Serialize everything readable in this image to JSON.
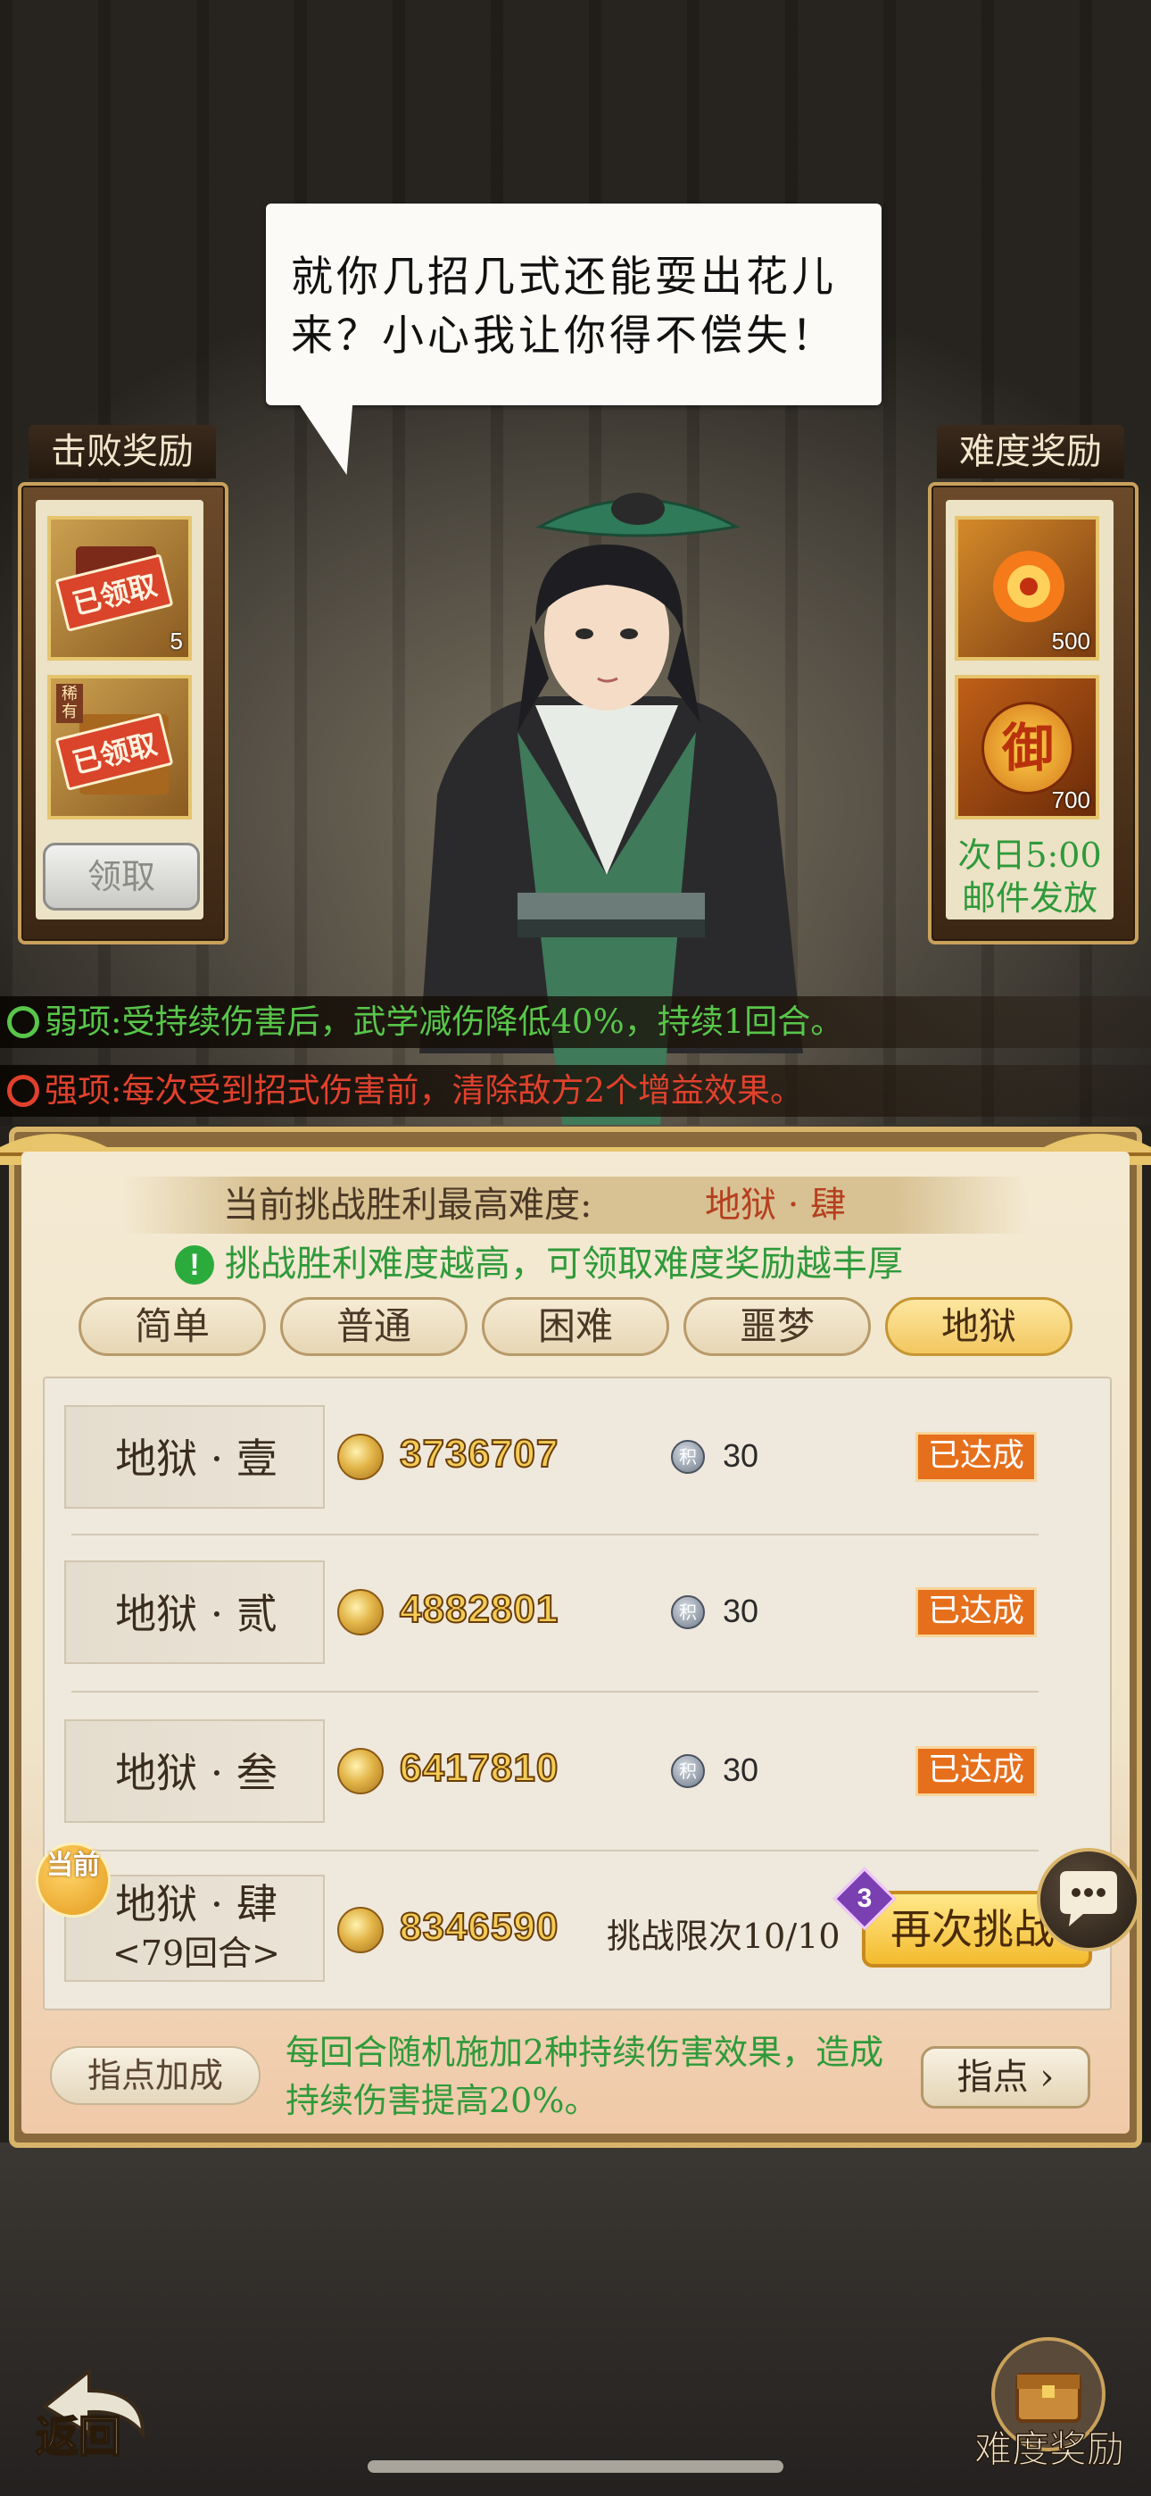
{
  "dialogue": "就你几招几式还能耍出花儿来？小心我让你得不偿失！",
  "defeat_rewards": {
    "title": "击败奖励",
    "items": [
      {
        "stamp": "已领取",
        "count": "5",
        "icon": "scroll-icon"
      },
      {
        "tag": "稀有",
        "stamp": "已领取",
        "icon": "chest-icon"
      }
    ],
    "claim_label": "领取"
  },
  "difficulty_rewards": {
    "title": "难度奖励",
    "items": [
      {
        "count": "500",
        "icon": "flame-flower-icon"
      },
      {
        "glyph": "御",
        "count": "700",
        "icon": "imperial-token-icon"
      }
    ],
    "note_line1": "次日5:00",
    "note_line2": "邮件发放"
  },
  "weakness": {
    "prefix": "弱项:",
    "text": "受持续伤害后，武学减伤降低40%，持续1回合。",
    "color": "#58c64a"
  },
  "strength": {
    "prefix": "强项:",
    "text": "每次受到招式伤害前，清除敌方2个增益效果。",
    "color": "#e0412d"
  },
  "panel": {
    "current_label": "当前挑战胜利最高难度:",
    "current_value": "地狱 · 肆",
    "tip": "挑战胜利难度越高，可领取难度奖励越丰厚",
    "tabs": [
      "简单",
      "普通",
      "困难",
      "噩梦",
      "地狱"
    ],
    "active_tab": "地狱",
    "rows": [
      {
        "name": "地狱 · 壹",
        "score": "3736707",
        "points": "30",
        "status": "已达成"
      },
      {
        "name": "地狱 · 贰",
        "score": "4882801",
        "points": "30",
        "status": "已达成"
      },
      {
        "name": "地狱 · 叁",
        "score": "6417810",
        "points": "30",
        "status": "已达成"
      },
      {
        "name": "地狱 · 肆",
        "sub": "<79回合>",
        "score": "8346590",
        "limit": "挑战限次10/10",
        "badge": "当前",
        "retry_count": "3",
        "retry_label": "再次挑战"
      }
    ],
    "point_icon_text": "积",
    "guide_label": "指点加成",
    "guide_text": "每回合随机施加2种持续伤害效果，造成持续伤害提高20%。",
    "guide_button": "指点 ›"
  },
  "nav": {
    "back_label": "返回",
    "reward_label": "难度奖励"
  }
}
